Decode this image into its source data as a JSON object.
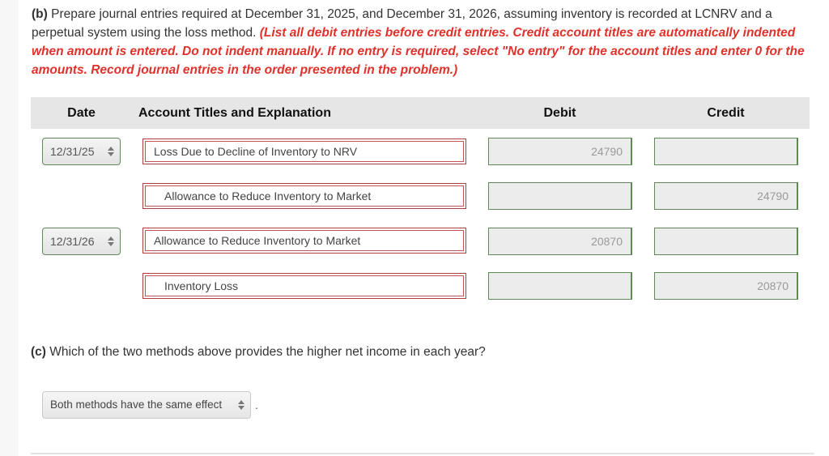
{
  "part_b": {
    "label": "(b)",
    "prompt": " Prepare journal entries required at December 31, 2025, and December 31, 2026, assuming inventory is recorded at LCNRV and a perpetual system using the loss method. ",
    "instruction_red": "(List all debit entries before credit entries. Credit account titles are automatically indented when amount is entered. Do not indent manually. If no entry is required, select \"No entry\" for the account titles and enter 0 for the amounts. Record journal entries in the order presented in the problem.)"
  },
  "journal_table": {
    "headers": {
      "date": "Date",
      "account": "Account Titles and Explanation",
      "debit": "Debit",
      "credit": "Credit"
    },
    "entries": [
      {
        "date": "12/31/25",
        "lines": [
          {
            "account": "Loss Due to Decline of Inventory to NRV",
            "debit": "24790",
            "credit": "",
            "indented": false
          },
          {
            "account": "Allowance to Reduce Inventory to Market",
            "debit": "",
            "credit": "24790",
            "indented": true
          }
        ]
      },
      {
        "date": "12/31/26",
        "lines": [
          {
            "account": "Allowance to Reduce Inventory to Market",
            "debit": "20870",
            "credit": "",
            "indented": false
          },
          {
            "account": "Inventory Loss",
            "debit": "",
            "credit": "20870",
            "indented": true
          }
        ]
      }
    ]
  },
  "part_c": {
    "label": "(c)",
    "question": " Which of the two methods above provides the higher net income in each year?",
    "answer_selected": "Both methods have the same effect",
    "trailing": "."
  },
  "colors": {
    "instruction_red": "#e0312b",
    "account_border": "#b04040",
    "amount_border": "#5f8a58",
    "header_bg": "#e6e6e6"
  }
}
